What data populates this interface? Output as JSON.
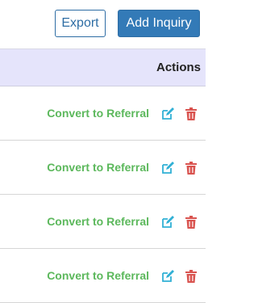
{
  "toolbar": {
    "export_label": "Export",
    "add_label": "Add Inquiry"
  },
  "table": {
    "header_actions": "Actions",
    "rows": [
      {
        "action_label": "Convert to Referral",
        "edit_icon": "edit-icon",
        "delete_icon": "trash-icon"
      },
      {
        "action_label": "Convert to Referral",
        "edit_icon": "edit-icon",
        "delete_icon": "trash-icon"
      },
      {
        "action_label": "Convert to Referral",
        "edit_icon": "edit-icon",
        "delete_icon": "trash-icon"
      },
      {
        "action_label": "Convert to Referral",
        "edit_icon": "edit-icon",
        "delete_icon": "trash-icon"
      }
    ]
  },
  "colors": {
    "primary": "#337ab7",
    "success": "#5cb85c",
    "danger": "#d9534f",
    "info": "#31b0d5",
    "header_bg": "#e5e4fb"
  }
}
